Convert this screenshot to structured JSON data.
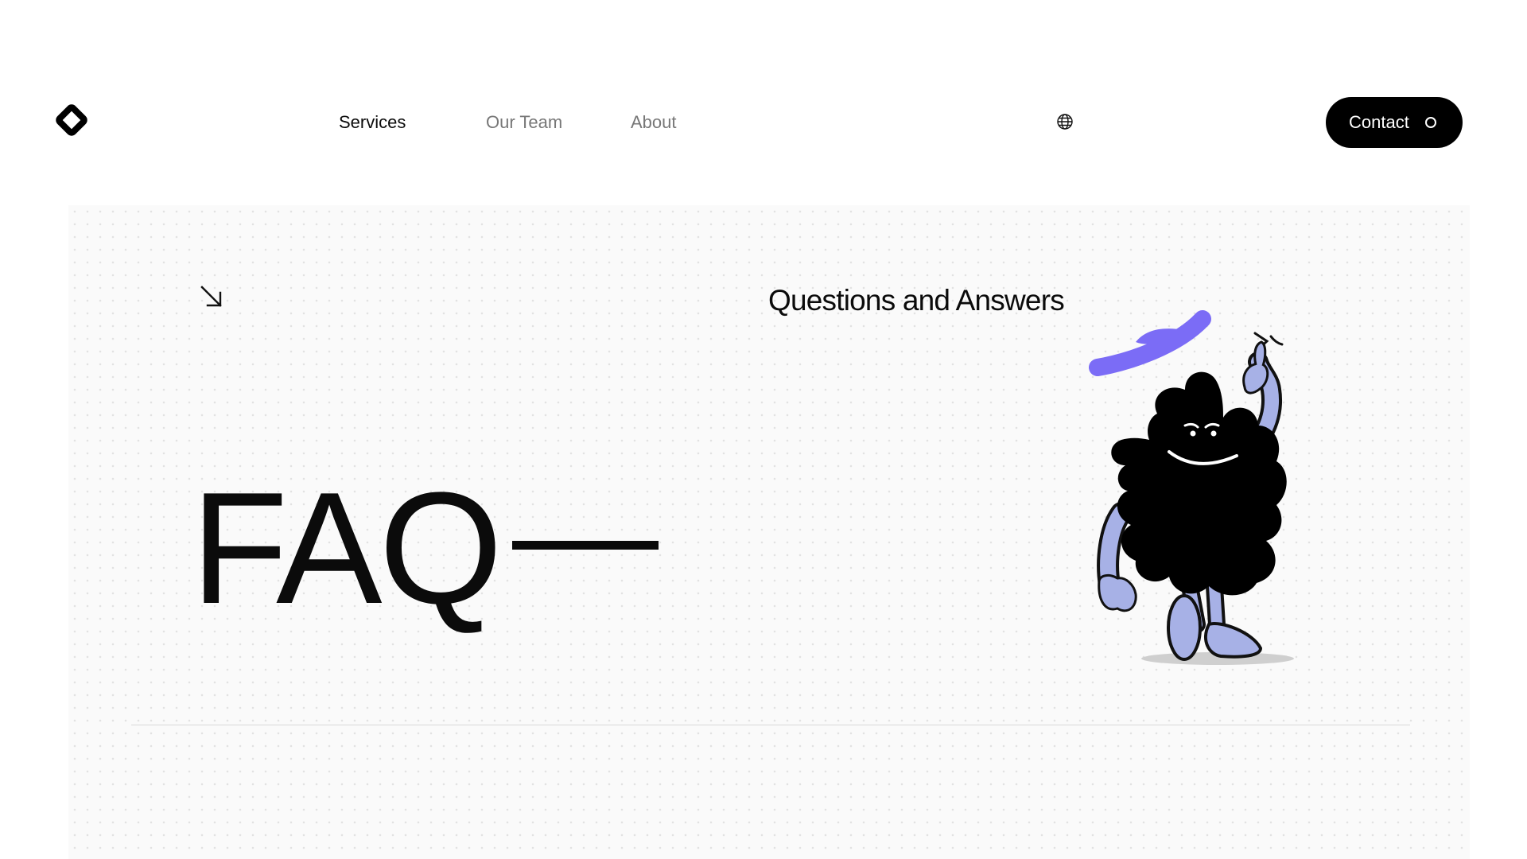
{
  "header": {
    "logo_icon": "diamond-logo-icon",
    "nav": [
      {
        "label": "Services",
        "active": true
      },
      {
        "label": "Our Team",
        "active": false
      },
      {
        "label": "About",
        "active": false
      }
    ],
    "language_icon": "globe-icon",
    "contact_label": "Contact"
  },
  "hero": {
    "arrow_icon": "arrow-down-right-icon",
    "subtitle": "Questions and Answers",
    "title": "FAQ",
    "illustration": "mascot-illustration",
    "accent_color": "#7B6CF6",
    "illustration_limb_color": "#A7B1E6"
  }
}
